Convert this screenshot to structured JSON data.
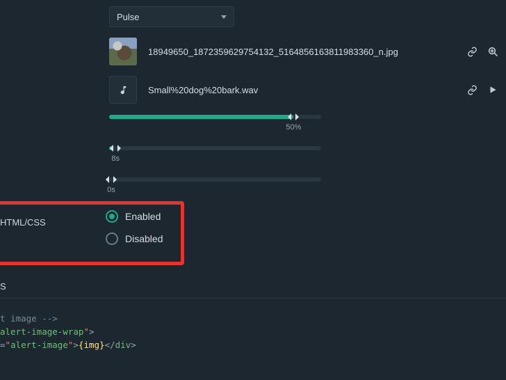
{
  "dropdown": {
    "selected": "Pulse"
  },
  "image_file": {
    "name": "18949650_1872359629754132_5164856163811983360_n.jpg"
  },
  "audio_file": {
    "name": "Small%20dog%20bark.wav"
  },
  "sliders": {
    "volume": {
      "percent": 50,
      "fill_pct": 87,
      "label": "50%"
    },
    "duration1": {
      "fill_pct": 2,
      "handle_pct": 3,
      "label": "8s"
    },
    "duration2": {
      "fill_pct": 0,
      "handle_pct": 1,
      "label": "0s"
    }
  },
  "htmlcss": {
    "section_label": "HTML/CSS",
    "options": {
      "enabled": "Enabled",
      "disabled": "Disabled"
    },
    "selected": "enabled"
  },
  "section_s": "S",
  "code": {
    "line1_comment": "t image -->",
    "line2_class": "alert-image-wrap",
    "line3_id": "alert-image",
    "line3_var": "{img}"
  },
  "colors": {
    "accent": "#1fab89",
    "highlight": "#e3342f",
    "bg": "#1c2730"
  }
}
